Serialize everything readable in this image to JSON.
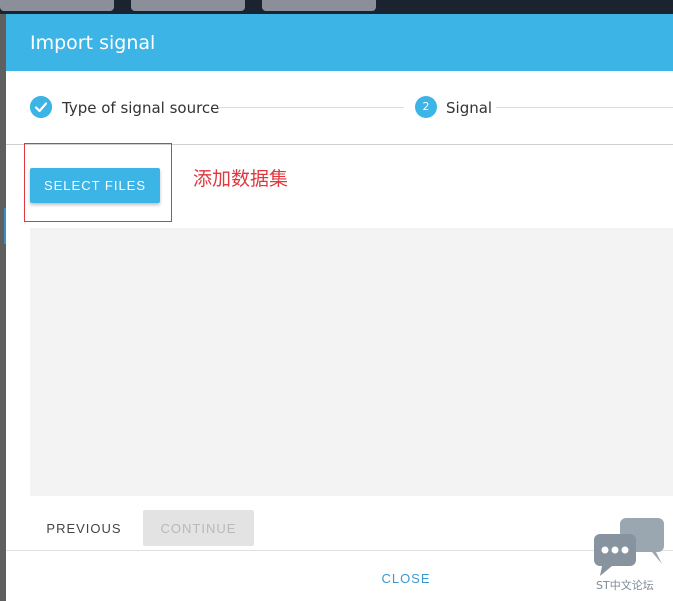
{
  "dialog": {
    "title": "Import signal",
    "header_color": "#3cb4e5"
  },
  "stepper": {
    "steps": [
      {
        "label": "Type of signal source",
        "state": "completed",
        "icon": "check-icon"
      },
      {
        "label": "Signal",
        "state": "active",
        "number": "2"
      }
    ]
  },
  "body": {
    "select_files_label": "SELECT FILES",
    "annotation": "添加数据集"
  },
  "footer": {
    "previous_label": "PREVIOUS",
    "continue_label": "CONTINUE",
    "close_label": "CLOSE"
  },
  "watermark": {
    "text": "ST中文论坛"
  },
  "colors": {
    "accent": "#3cb4e5",
    "annotation_red": "#e0383e",
    "close_link": "#3c9ad0"
  }
}
